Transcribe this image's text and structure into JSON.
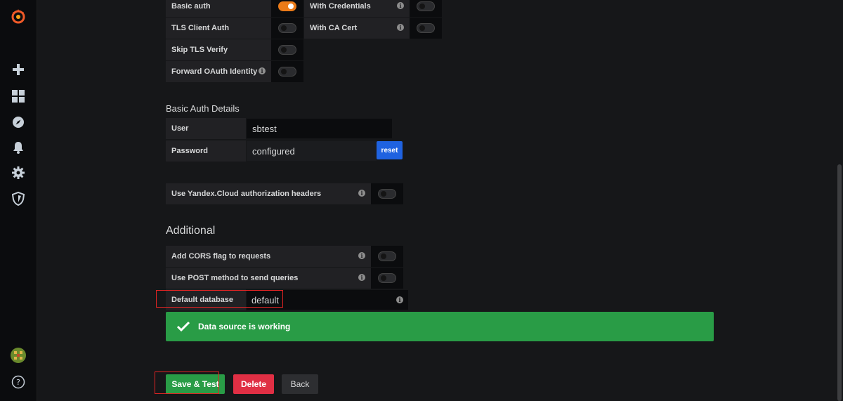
{
  "sidebar": {
    "items": [
      {
        "name": "grafana-logo-icon"
      },
      {
        "name": "plus-icon"
      },
      {
        "name": "dashboards-icon"
      },
      {
        "name": "explore-icon"
      },
      {
        "name": "alerting-bell-icon"
      },
      {
        "name": "configuration-gear-icon"
      },
      {
        "name": "server-admin-shield-icon"
      },
      {
        "name": "user-avatar"
      },
      {
        "name": "help-icon"
      }
    ]
  },
  "auth": {
    "basic_auth": "Basic auth",
    "with_credentials": "With Credentials",
    "tls_client_auth": "TLS Client Auth",
    "with_ca_cert": "With CA Cert",
    "skip_tls_verify": "Skip TLS Verify",
    "forward_oauth": "Forward OAuth Identity",
    "basic_auth_on": true
  },
  "basic_auth_details": {
    "title": "Basic Auth Details",
    "user_label": "User",
    "user_value": "sbtest",
    "password_label": "Password",
    "password_value": "configured",
    "reset_label": "reset"
  },
  "yandex": {
    "label": "Use Yandex.Cloud authorization headers"
  },
  "additional": {
    "title": "Additional",
    "cors_label": "Add CORS flag to requests",
    "post_label": "Use POST method to send queries",
    "default_db_label": "Default database",
    "default_db_value": "default"
  },
  "status": {
    "message": "Data source is working"
  },
  "actions": {
    "save_test": "Save & Test",
    "delete": "Delete",
    "back": "Back"
  },
  "colors": {
    "accent_orange": "#eb7b18",
    "success_green": "#299c46",
    "danger_red": "#e02f44",
    "primary_blue": "#1f62e0"
  }
}
